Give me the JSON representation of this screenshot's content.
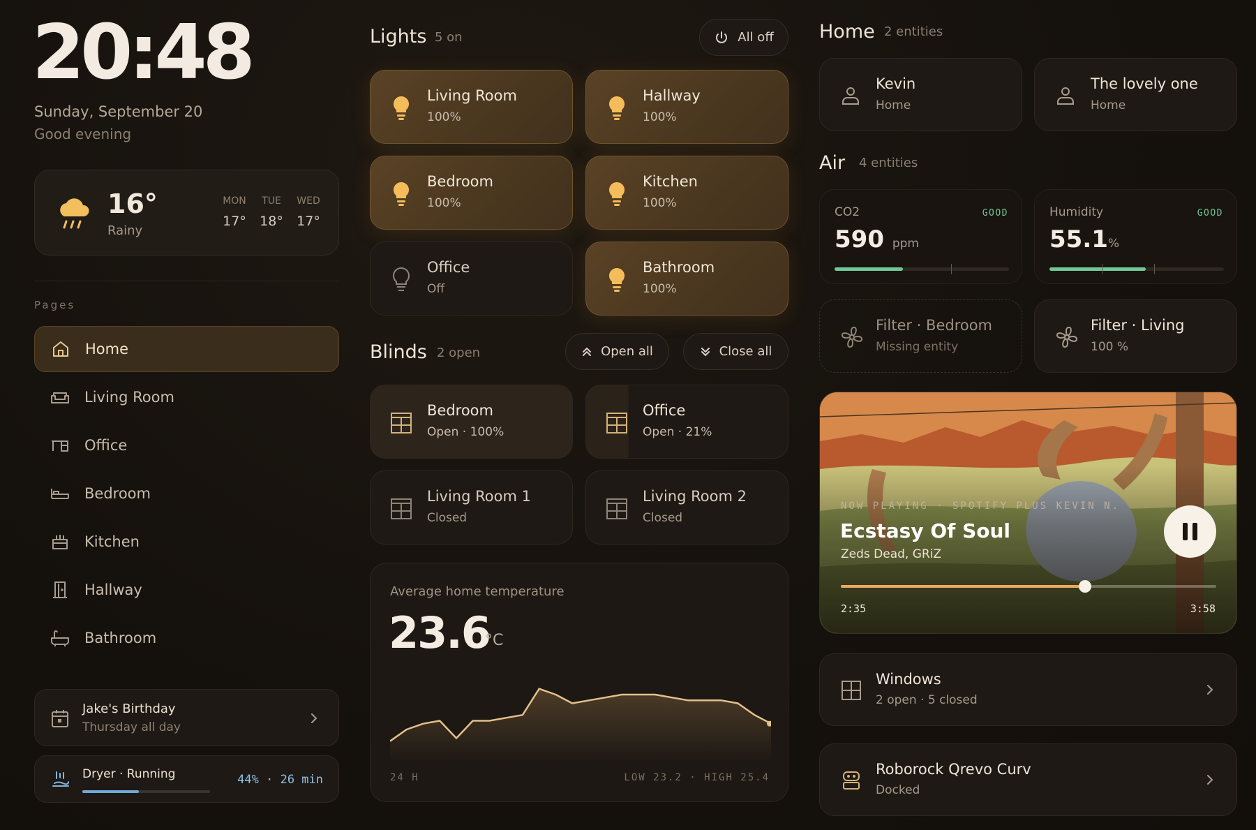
{
  "clock": {
    "time": "20:48",
    "date": "Sunday, September 20",
    "greeting": "Good evening"
  },
  "weather": {
    "icon": "rain-cloud-icon",
    "temp": "16°",
    "condition": "Rainy",
    "forecast": [
      {
        "day": "MON",
        "temp": "17°"
      },
      {
        "day": "TUE",
        "temp": "18°"
      },
      {
        "day": "WED",
        "temp": "17°"
      }
    ]
  },
  "nav": {
    "heading": "Pages",
    "items": [
      {
        "label": "Home",
        "icon": "home-icon",
        "active": true
      },
      {
        "label": "Living Room",
        "icon": "sofa-icon"
      },
      {
        "label": "Office",
        "icon": "desk-icon"
      },
      {
        "label": "Bedroom",
        "icon": "bed-icon"
      },
      {
        "label": "Kitchen",
        "icon": "stove-icon"
      },
      {
        "label": "Hallway",
        "icon": "door-icon"
      },
      {
        "label": "Bathroom",
        "icon": "bathtub-icon"
      }
    ]
  },
  "events": {
    "birthday": {
      "title": "Jake's Birthday",
      "when": "Thursday all day"
    },
    "dryer": {
      "title": "Dryer · Running",
      "progress": 0.44,
      "value": "44% · 26 min"
    }
  },
  "lights": {
    "title": "Lights",
    "count": "5 on",
    "all_off_label": "All off",
    "items": [
      {
        "name": "Living Room",
        "state": "100%",
        "on": true
      },
      {
        "name": "Hallway",
        "state": "100%",
        "on": true
      },
      {
        "name": "Bedroom",
        "state": "100%",
        "on": true
      },
      {
        "name": "Kitchen",
        "state": "100%",
        "on": true
      },
      {
        "name": "Office",
        "state": "Off",
        "on": false
      },
      {
        "name": "Bathroom",
        "state": "100%",
        "on": true
      }
    ]
  },
  "blinds": {
    "title": "Blinds",
    "count": "2 open",
    "open_all_label": "Open all",
    "close_all_label": "Close all",
    "items": [
      {
        "name": "Bedroom",
        "state": "Open · 100%",
        "position": 1.0
      },
      {
        "name": "Office",
        "state": "Open · 21%",
        "position": 0.21
      },
      {
        "name": "Living Room 1",
        "state": "Closed",
        "position": 0
      },
      {
        "name": "Living Room 2",
        "state": "Closed",
        "position": 0
      }
    ]
  },
  "temperature": {
    "label": "Average home temperature",
    "value": "23.6",
    "unit": "°C",
    "range_label": "24 H",
    "low_high": "LOW 23.2 · HIGH 25.4",
    "line_color": "#e3c08c"
  },
  "chart_data": {
    "type": "area",
    "title": "Average home temperature",
    "xlabel": "24 H",
    "ylabel": "",
    "x": [
      0,
      1,
      2,
      3,
      4,
      5,
      6,
      7,
      8,
      9,
      10,
      11,
      12,
      13,
      14,
      15,
      16,
      17,
      18,
      19,
      20,
      21,
      22,
      23
    ],
    "values": [
      23.2,
      23.6,
      23.8,
      23.9,
      23.3,
      23.9,
      23.9,
      24.0,
      24.1,
      25.0,
      24.8,
      24.5,
      24.6,
      24.7,
      24.8,
      24.8,
      24.8,
      24.7,
      24.6,
      24.6,
      24.6,
      24.5,
      24.1,
      23.8
    ],
    "ylim": [
      23.0,
      25.4
    ]
  },
  "home": {
    "title": "Home",
    "count": "2 entities",
    "people": [
      {
        "name": "Kevin",
        "state": "Home"
      },
      {
        "name": "The lovely one",
        "state": "Home"
      }
    ]
  },
  "air": {
    "title": "Air",
    "count": "4 entities",
    "sensors": [
      {
        "name": "CO2",
        "badge": "GOOD",
        "value": "590",
        "unit": "ppm",
        "level": 0.39
      },
      {
        "name": "Humidity",
        "badge": "GOOD",
        "value": "55.1",
        "unit": "%",
        "level": 0.55
      }
    ],
    "filters": [
      {
        "name": "Filter · Bedroom",
        "state": "Missing entity",
        "missing": true
      },
      {
        "name": "Filter · Living",
        "state": "100 %",
        "missing": false
      }
    ]
  },
  "player": {
    "now_playing": "NOW PLAYING · SPOTIFY PLUS KEVIN N.",
    "song": "Ecstasy Of Soul",
    "artist": "Zeds Dead, GRiZ",
    "elapsed": "2:35",
    "duration": "3:58",
    "progress": 0.65,
    "accent": "#f0a85a"
  },
  "windows": {
    "title": "Windows",
    "state": "2 open · 5 closed"
  },
  "vacuum": {
    "title": "Roborock Qrevo Curv",
    "state": "Docked"
  }
}
